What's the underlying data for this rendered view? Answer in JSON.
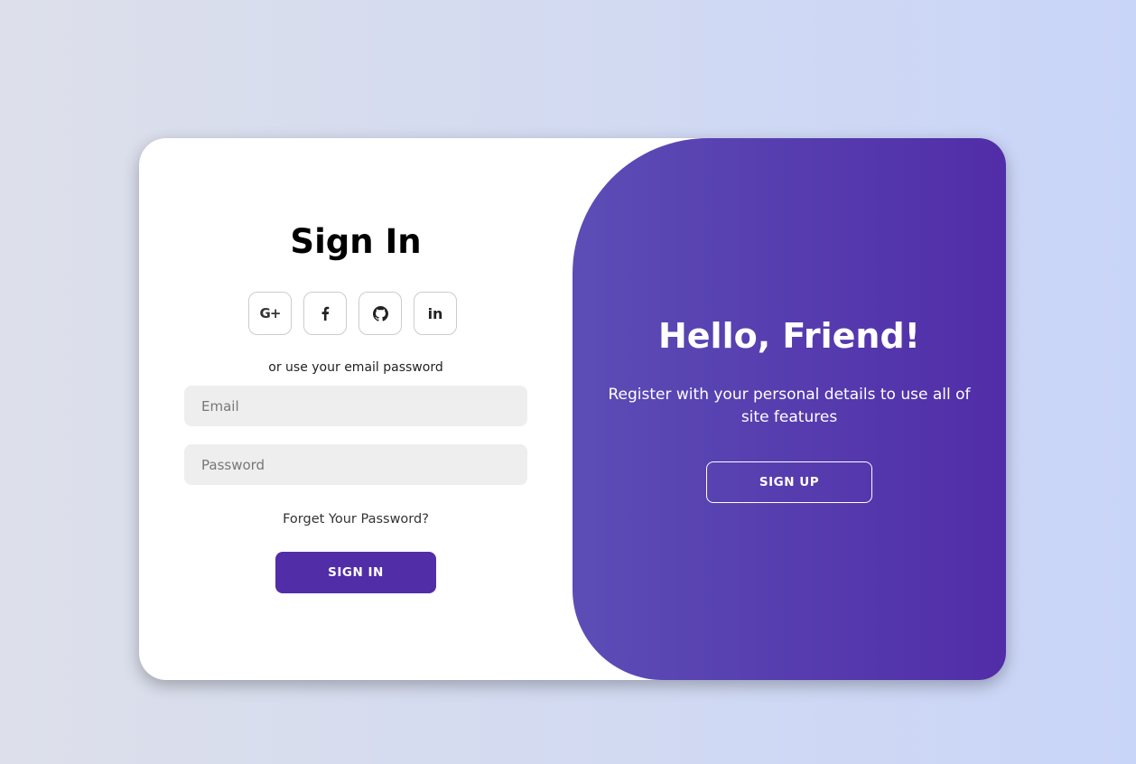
{
  "signin": {
    "title": "Sign In",
    "socials": [
      {
        "name": "google-plus",
        "icon": "google-plus-icon",
        "label": "G+"
      },
      {
        "name": "facebook",
        "icon": "facebook-icon"
      },
      {
        "name": "github",
        "icon": "github-icon"
      },
      {
        "name": "linkedin",
        "icon": "linkedin-icon",
        "label": "in"
      }
    ],
    "or_text": "or use your email password",
    "email_placeholder": "Email",
    "password_placeholder": "Password",
    "forgot_text": "Forget Your Password?",
    "button_label": "SIGN IN"
  },
  "overlay": {
    "title": "Hello, Friend!",
    "text": "Register with your personal details to use all of site features",
    "button_label": "SIGN UP"
  },
  "colors": {
    "accent": "#512da8",
    "gradient_start": "#5c4db6",
    "input_bg": "#eeeeee"
  }
}
